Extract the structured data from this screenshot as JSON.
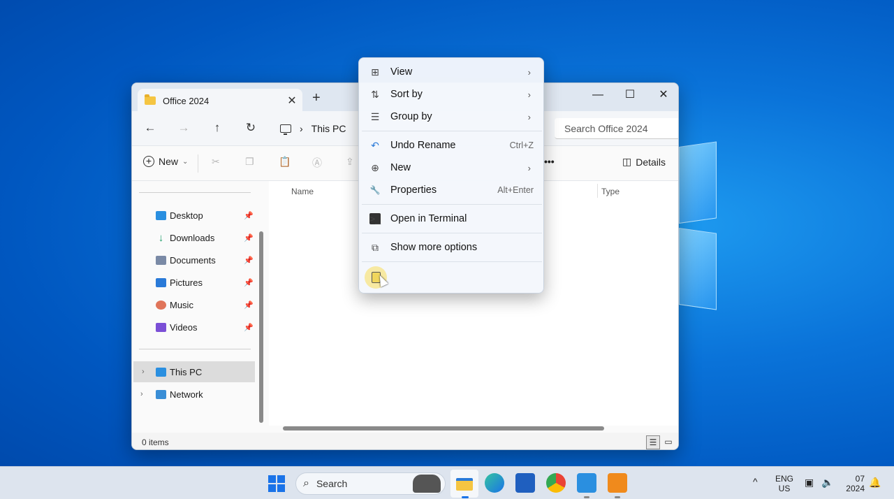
{
  "explorer": {
    "tab_title": "Office 2024",
    "new_tab": "+",
    "tab_close": "✕",
    "window_controls": {
      "minimize": "—",
      "maximize": "☐",
      "close": "✕"
    },
    "address": {
      "back": "←",
      "forward": "→",
      "up": "↑",
      "refresh": "↻",
      "breadcrumb_sep": "›",
      "breadcrumb": "This PC",
      "search_placeholder": "Search Office 2024"
    },
    "toolbar": {
      "new_label": "New",
      "new_chevron": "⌄",
      "more": "•••",
      "details_label": "Details"
    },
    "nav": {
      "quick_access": [
        {
          "label": "Desktop",
          "icon": "desktop-icon",
          "color": "#2a8fe0"
        },
        {
          "label": "Downloads",
          "icon": "downloads-icon",
          "color": "#1e9e6a"
        },
        {
          "label": "Documents",
          "icon": "documents-icon",
          "color": "#7a8aa6"
        },
        {
          "label": "Pictures",
          "icon": "pictures-icon",
          "color": "#2a7ad8"
        },
        {
          "label": "Music",
          "icon": "music-icon",
          "color": "#e0755a"
        },
        {
          "label": "Videos",
          "icon": "videos-icon",
          "color": "#7b4fd6"
        }
      ],
      "pin_glyph": "📌",
      "expand_glyph": "›",
      "this_pc": "This PC",
      "network": "Network"
    },
    "columns": {
      "name": "Name",
      "type": "Type"
    },
    "status": {
      "items": "0 items"
    }
  },
  "context_menu": {
    "items": [
      {
        "label": "View",
        "icon": "view-icon",
        "glyph": "⊞",
        "arrow": "›"
      },
      {
        "label": "Sort by",
        "icon": "sort-icon",
        "glyph": "⇅",
        "arrow": "›"
      },
      {
        "label": "Group by",
        "icon": "group-icon",
        "glyph": "☰",
        "arrow": "›"
      },
      {
        "label": "Undo Rename",
        "icon": "undo-icon",
        "glyph": "↶",
        "shortcut": "Ctrl+Z"
      },
      {
        "label": "New",
        "icon": "new-icon",
        "glyph": "⊕",
        "arrow": "›"
      },
      {
        "label": "Properties",
        "icon": "wrench-icon",
        "glyph": "🔧",
        "shortcut": "Alt+Enter"
      },
      {
        "label": "Open in Terminal",
        "icon": "terminal-icon",
        "glyph": ">_"
      },
      {
        "label": "Show more options",
        "icon": "share-more-icon",
        "glyph": "⧉"
      }
    ]
  },
  "taskbar": {
    "search_label": "Search",
    "tray": {
      "lang_top": "ENG",
      "lang_bottom": "US",
      "date_top": "07",
      "date_bottom": "2024",
      "chevron": "^"
    }
  },
  "colors": {
    "accent": "#1a73e8",
    "desktop": "#0a73d9"
  }
}
